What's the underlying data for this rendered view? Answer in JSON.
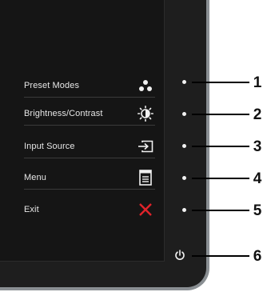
{
  "menu": {
    "items": [
      {
        "label": "Preset Modes",
        "icon": "preset-modes-icon",
        "callout": "1"
      },
      {
        "label": "Brightness/Contrast",
        "icon": "brightness-contrast-icon",
        "callout": "2"
      },
      {
        "label": "Input Source",
        "icon": "input-source-icon",
        "callout": "3"
      },
      {
        "label": "Menu",
        "icon": "menu-icon",
        "callout": "4"
      },
      {
        "label": "Exit",
        "icon": "exit-icon",
        "callout": "5"
      }
    ]
  },
  "power": {
    "icon": "power-icon",
    "callout": "6"
  },
  "colors": {
    "exit": "#e0232a",
    "bezel": "#1e1e1e",
    "frame": "#8a8f93"
  }
}
